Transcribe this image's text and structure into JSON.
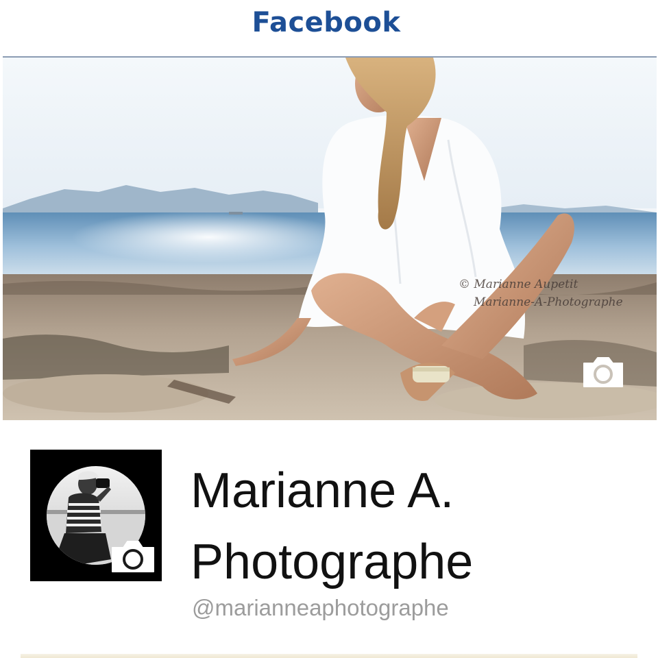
{
  "header": {
    "title": "Facebook",
    "title_color": "#1d4f96"
  },
  "cover": {
    "description_icon": "camera-icon",
    "watermark_line1": "© Marianne Aupetit",
    "watermark_line2": "Marianne-A-Photographe",
    "camera_icon": "camera-icon"
  },
  "profile": {
    "avatar_icon": "camera-icon",
    "name_line1": "Marianne A.",
    "name_line2": "Photographe",
    "handle": "@marianneaphotographe"
  }
}
